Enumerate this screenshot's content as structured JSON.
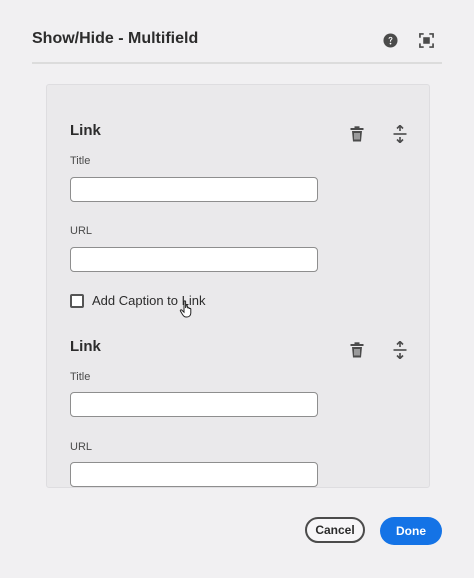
{
  "dialog": {
    "title": "Show/Hide - Multifield",
    "icons": {
      "help": "help-icon",
      "fullscreen": "fullscreen-icon"
    }
  },
  "items": [
    {
      "heading": "Link",
      "title_label": "Title",
      "title_value": "",
      "url_label": "URL",
      "url_value": "",
      "checkbox_label": "Add Caption to Link",
      "checkbox_checked": false,
      "delete_icon": "trash-icon",
      "reorder_icon": "reorder-icon"
    },
    {
      "heading": "Link",
      "title_label": "Title",
      "title_value": "",
      "url_label": "URL",
      "url_value": "",
      "delete_icon": "trash-icon",
      "reorder_icon": "reorder-icon"
    }
  ],
  "footer": {
    "cancel_label": "Cancel",
    "done_label": "Done"
  },
  "colors": {
    "accent": "#1473e6",
    "background": "#f1f0f2",
    "panel": "#eae9eb"
  }
}
